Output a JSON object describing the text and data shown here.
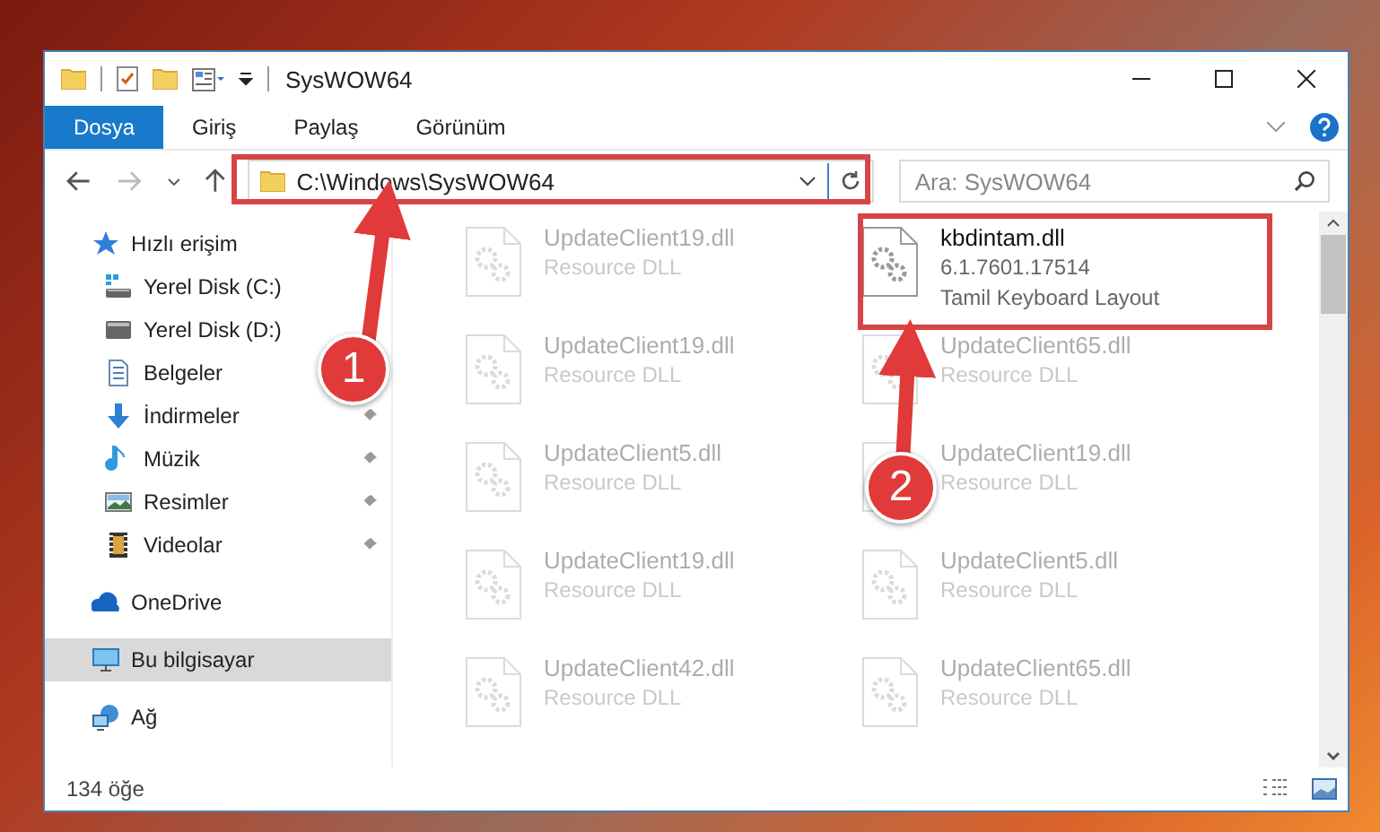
{
  "window": {
    "title": "SysWOW64"
  },
  "ribbon": {
    "tabs": [
      {
        "label": "Dosya",
        "selected": true
      },
      {
        "label": "Giriş",
        "selected": false
      },
      {
        "label": "Paylaş",
        "selected": false
      },
      {
        "label": "Görünüm",
        "selected": false
      }
    ]
  },
  "address_bar": {
    "path": "C:\\Windows\\SysWOW64"
  },
  "search": {
    "placeholder": "Ara: SysWOW64"
  },
  "sidebar": {
    "items": [
      {
        "label": "Hızlı erişim",
        "kind": "quick",
        "selected": false,
        "children": [
          {
            "label": "Yerel Disk (C:)",
            "kind": "system-drive",
            "selected": false,
            "pinned": false
          },
          {
            "label": "Yerel Disk (D:)",
            "kind": "drive",
            "selected": false,
            "pinned": false
          },
          {
            "label": "Belgeler",
            "kind": "docs",
            "selected": false,
            "pinned": false
          },
          {
            "label": "İndirmeler",
            "kind": "download",
            "selected": false,
            "pinned": true
          },
          {
            "label": "Müzik",
            "kind": "music",
            "selected": false,
            "pinned": true
          },
          {
            "label": "Resimler",
            "kind": "pictures",
            "selected": false,
            "pinned": true
          },
          {
            "label": "Videolar",
            "kind": "videos",
            "selected": false,
            "pinned": true
          }
        ]
      },
      {
        "label": "OneDrive",
        "kind": "cloud",
        "selected": false
      },
      {
        "label": "Bu bilgisayar",
        "kind": "computer",
        "selected": true
      },
      {
        "label": "Ağ",
        "kind": "network",
        "selected": false
      }
    ]
  },
  "files": [
    {
      "name": "UpdateClient19.dll",
      "type": "Resource DLL",
      "faded": true
    },
    {
      "name": "kbdintam.dll",
      "version": "6.1.7601.17514",
      "type": "Tamil Keyboard Layout",
      "faded": false
    },
    {
      "name": "UpdateClient19.dll",
      "type": "Resource DLL",
      "faded": true
    },
    {
      "name": "UpdateClient65.dll",
      "type": "Resource DLL",
      "faded": true
    },
    {
      "name": "UpdateClient5.dll",
      "type": "Resource DLL",
      "faded": true
    },
    {
      "name": "UpdateClient19.dll",
      "type": "Resource DLL",
      "faded": true
    },
    {
      "name": "UpdateClient19.dll",
      "type": "Resource DLL",
      "faded": true
    },
    {
      "name": "UpdateClient5.dll",
      "type": "Resource DLL",
      "faded": true
    },
    {
      "name": "UpdateClient42.dll",
      "type": "Resource DLL",
      "faded": true
    },
    {
      "name": "UpdateClient65.dll",
      "type": "Resource DLL",
      "faded": true
    }
  ],
  "status_bar": {
    "count": "134 öğe"
  },
  "annotations": [
    {
      "label": "1"
    },
    {
      "label": "2"
    }
  ]
}
